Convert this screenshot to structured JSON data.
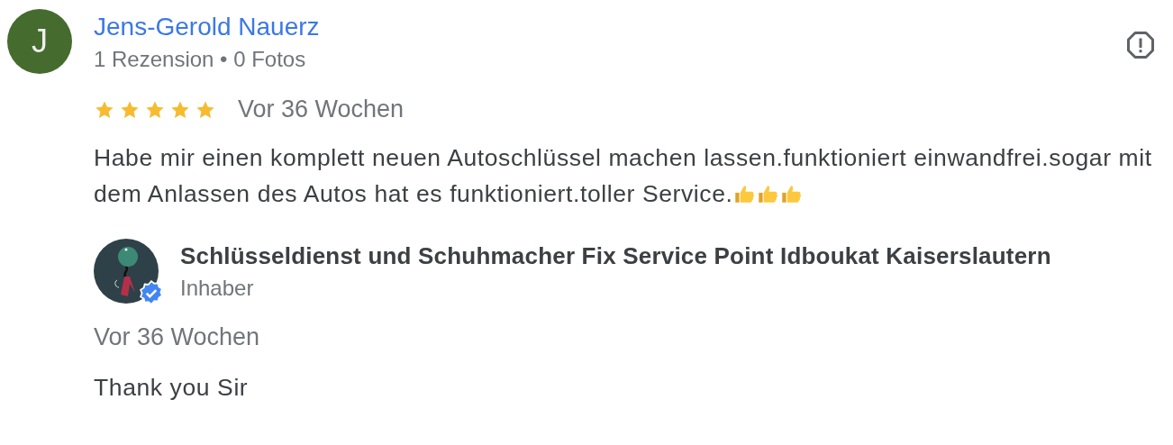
{
  "review": {
    "author": {
      "initial": "J",
      "name": "Jens-Gerold Nauerz",
      "meta": "1 Rezension • 0 Fotos"
    },
    "stars": 5,
    "time": "Vor 36 Wochen",
    "text": "Habe mir einen komplett neuen Autoschlüssel machen lassen.funktioniert einwandfrei.sogar mit dem Anlassen des Autos hat es funktioniert.toller Service.",
    "reactions": [
      {
        "kind": "thumbs-up"
      },
      {
        "kind": "thumbs-up"
      },
      {
        "kind": "thumbs-up"
      }
    ],
    "reply": {
      "owner": "Schlüsseldienst und Schuhmacher Fix Service Point Idboukat Kaiserslautern",
      "role": "Inhaber",
      "verified": true,
      "time": "Vor 36 Wochen",
      "text": "Thank you Sir"
    }
  }
}
